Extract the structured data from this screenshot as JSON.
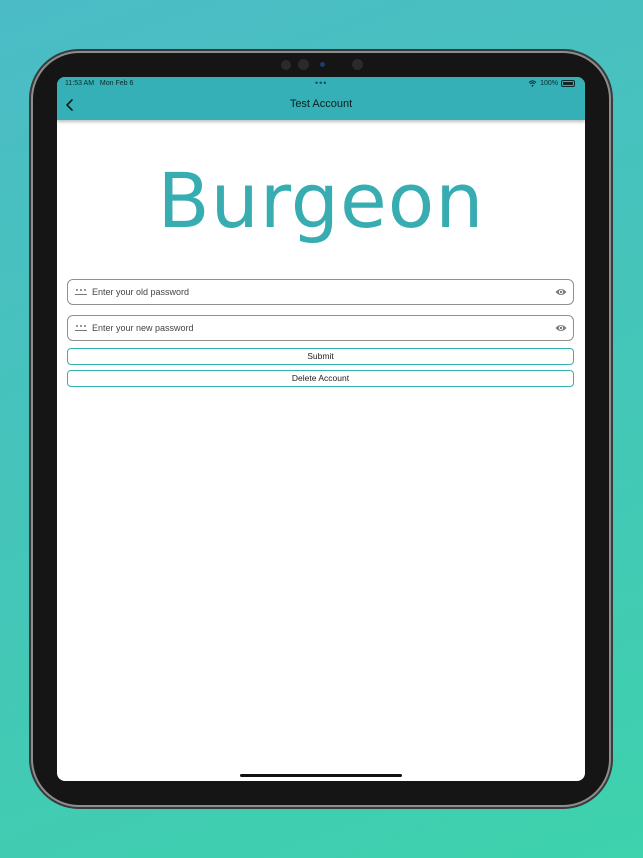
{
  "status_bar": {
    "time": "11:53 AM",
    "date": "Mon Feb 6",
    "dots": "•••",
    "battery": "100%"
  },
  "nav": {
    "title": "Test Account",
    "back_icon": "chevron-left-icon"
  },
  "logo": {
    "text": "Burgeon",
    "color": "#37adb2"
  },
  "form": {
    "old_password": {
      "value": "",
      "placeholder": "Enter your old password"
    },
    "new_password": {
      "value": "",
      "placeholder": "Enter your new password"
    },
    "submit_label": "Submit",
    "delete_label": "Delete Account"
  },
  "colors": {
    "accent": "#35b0b6",
    "background_top": "#4bbcc6",
    "background_bottom": "#3ed2ad"
  }
}
